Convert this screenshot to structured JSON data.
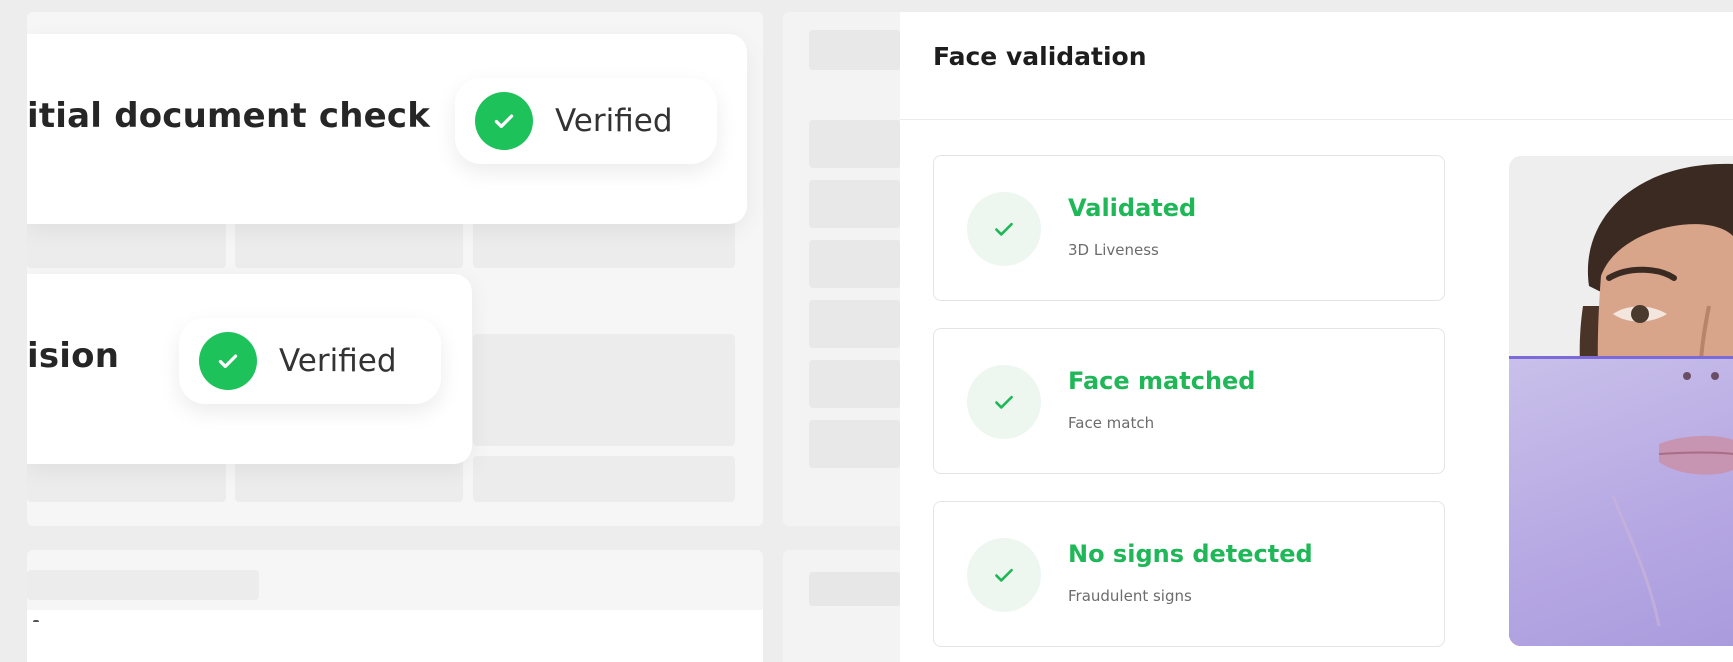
{
  "background_steps": {
    "document_check": {
      "label": "itial document check",
      "status": "Verified",
      "status_icon": "check-icon"
    },
    "decision": {
      "label": "ision",
      "status": "Verified",
      "status_icon": "check-icon"
    }
  },
  "face_validation": {
    "title": "Face validation",
    "results": [
      {
        "title": "Validated",
        "subtitle": "3D Liveness",
        "icon": "check-icon"
      },
      {
        "title": "Face matched",
        "subtitle": "Face match",
        "icon": "check-icon"
      },
      {
        "title": "No signs detected",
        "subtitle": "Fraudulent signs",
        "icon": "check-icon"
      }
    ],
    "selfie": {
      "description_icon": "face-photo"
    }
  },
  "colors": {
    "accent_green": "#1ec25a",
    "result_green": "#1fb757",
    "scan_line": "#7b6ad8",
    "scan_overlay": "#b7a9e3"
  }
}
